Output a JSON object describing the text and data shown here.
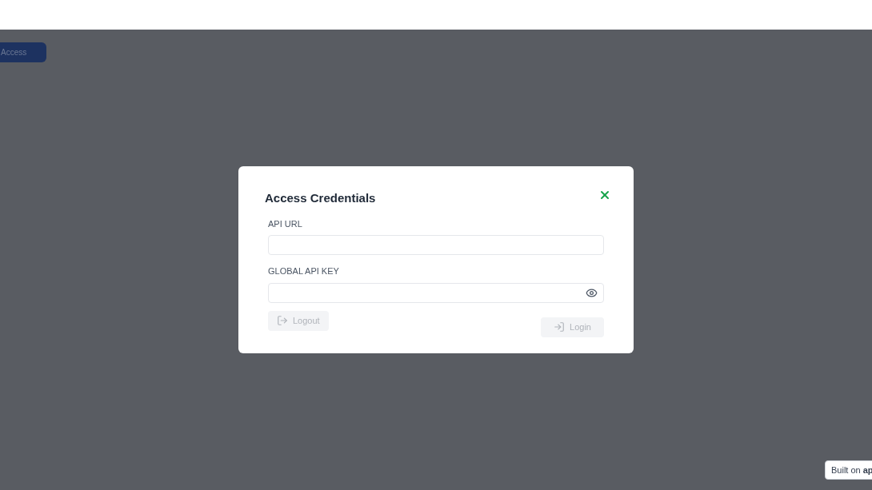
{
  "background_button": {
    "label": "Access"
  },
  "dialog": {
    "title": "Access Credentials",
    "fields": [
      {
        "label": "API URL",
        "kind": "text"
      },
      {
        "label": "GLOBAL API KEY",
        "kind": "password"
      }
    ],
    "buttons": [
      {
        "label": "Logout",
        "kind": "logout",
        "disabled": true
      },
      {
        "label": "Login",
        "kind": "login",
        "disabled": true
      }
    ]
  },
  "badge": {
    "text": "Built on **ap**"
  }
}
